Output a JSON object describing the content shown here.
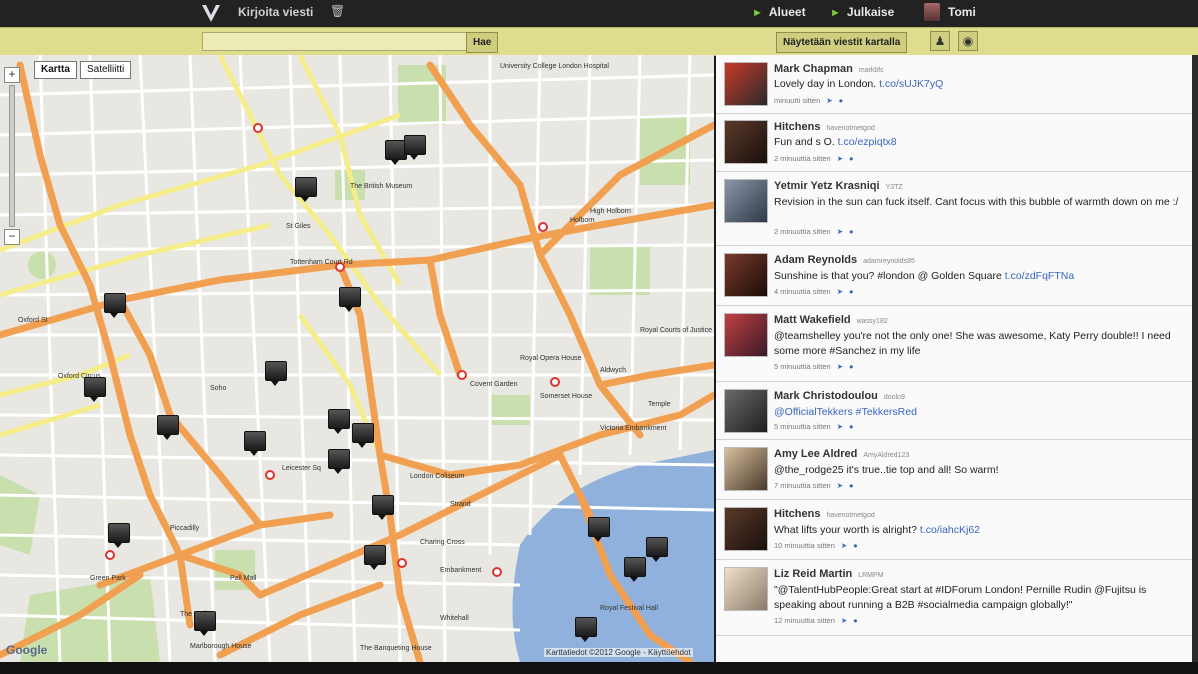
{
  "topbar": {
    "logo": "V",
    "write_message": "Kirjoita viesti",
    "nav": [
      {
        "label": "Alueet"
      },
      {
        "label": "Julkaise"
      },
      {
        "label": "Tomi"
      }
    ]
  },
  "toolbar": {
    "search_value": "",
    "search_button": "Hae",
    "show_on_map_button": "Näytetään viestit kartalla"
  },
  "map": {
    "map_types": [
      "Kartta",
      "Satelliitti"
    ],
    "active_type": "Kartta",
    "zoom_in": "+",
    "zoom_out": "−",
    "copyright": "Karttatiedot ©2012 Google - Käyttöehdot",
    "google": "Google",
    "labels": [
      "Oxford St",
      "Oxford Circus",
      "Soho",
      "St Giles",
      "Tottenham Court Rd",
      "Holborn",
      "High Holborn",
      "Covent Garden",
      "Strand",
      "Embankment",
      "Piccadilly",
      "Green Park",
      "Leicester Sq",
      "Charing Cross",
      "The Mall",
      "Temple",
      "Victoria Embankment",
      "Royal Courts of Justice",
      "London Coliseum",
      "University College London Hospital",
      "The British Museum",
      "Somerset House",
      "Royal Opera House",
      "Aldwych",
      "Whitehall",
      "Pall Mall",
      "Royal Festival Hall",
      "Marlborough House",
      "The Banqueting House"
    ]
  },
  "feed": {
    "tweets": [
      {
        "name": "Mark Chapman",
        "handle": "markbfc",
        "text": "Lovely day in London. ",
        "link": "t.co/sUJK7yQ",
        "time": "minuutti sitten"
      },
      {
        "name": "Hitchens",
        "handle": "havenotmetgod",
        "text": "Fun and s O. ",
        "link": "t.co/ezpiqtx8",
        "time": "2 minuuttia sitten"
      },
      {
        "name": "Yetmir Yetz Krasniqi",
        "handle": "Y3TZ",
        "text": "Revision in the sun can fuck itself. Cant focus with this bubble of warmth down on me :/",
        "link": "",
        "time": "2 minuuttia sitten"
      },
      {
        "name": "Adam Reynolds",
        "handle": "adamreynolds85",
        "text": "Sunshine is that you? #london @ Golden Square ",
        "link": "t.co/zdFqFTNa",
        "time": "4 minuuttia sitten"
      },
      {
        "name": "Matt Wakefield",
        "handle": "wassy182",
        "text": "@teamshelley you're not the only one! She was awesome, Katy Perry double!! I need some more #Sanchez in my life",
        "link": "",
        "time": "5 minuuttia sitten"
      },
      {
        "name": "Mark Christodoulou",
        "handle": "doolo9",
        "text": "@OfficialTekkers #TekkersRed",
        "link": "",
        "time": "5 minuuttia sitten"
      },
      {
        "name": "Amy Lee Aldred",
        "handle": "AmyAldred123",
        "text": "@the_rodge25 it's true..tie top and all! So warm!",
        "link": "",
        "time": "7 minuuttia sitten"
      },
      {
        "name": "Hitchens",
        "handle": "havenotmetgod",
        "text": "What lifts your worth is alright? ",
        "link": "t.co/iahcKj62",
        "time": "10 minuuttia sitten"
      },
      {
        "name": "Liz Reid Martin",
        "handle": "LRMPM",
        "text": "\"@TalentHubPeople:Great start at #IDForum London! Pernille Rudin @Fujitsu is speaking about running a B2B #socialmedia campaign globally!\"",
        "link": "",
        "time": "12 minuuttia sitten"
      }
    ]
  },
  "colors": {
    "toolbar": "#dedd8e",
    "major_road": "#f0a050",
    "minor_road": "#ffffff",
    "yellow_road": "#f5ec8a",
    "park": "#c9dfae",
    "water": "#8fb1dc",
    "link": "#3a64c0"
  }
}
